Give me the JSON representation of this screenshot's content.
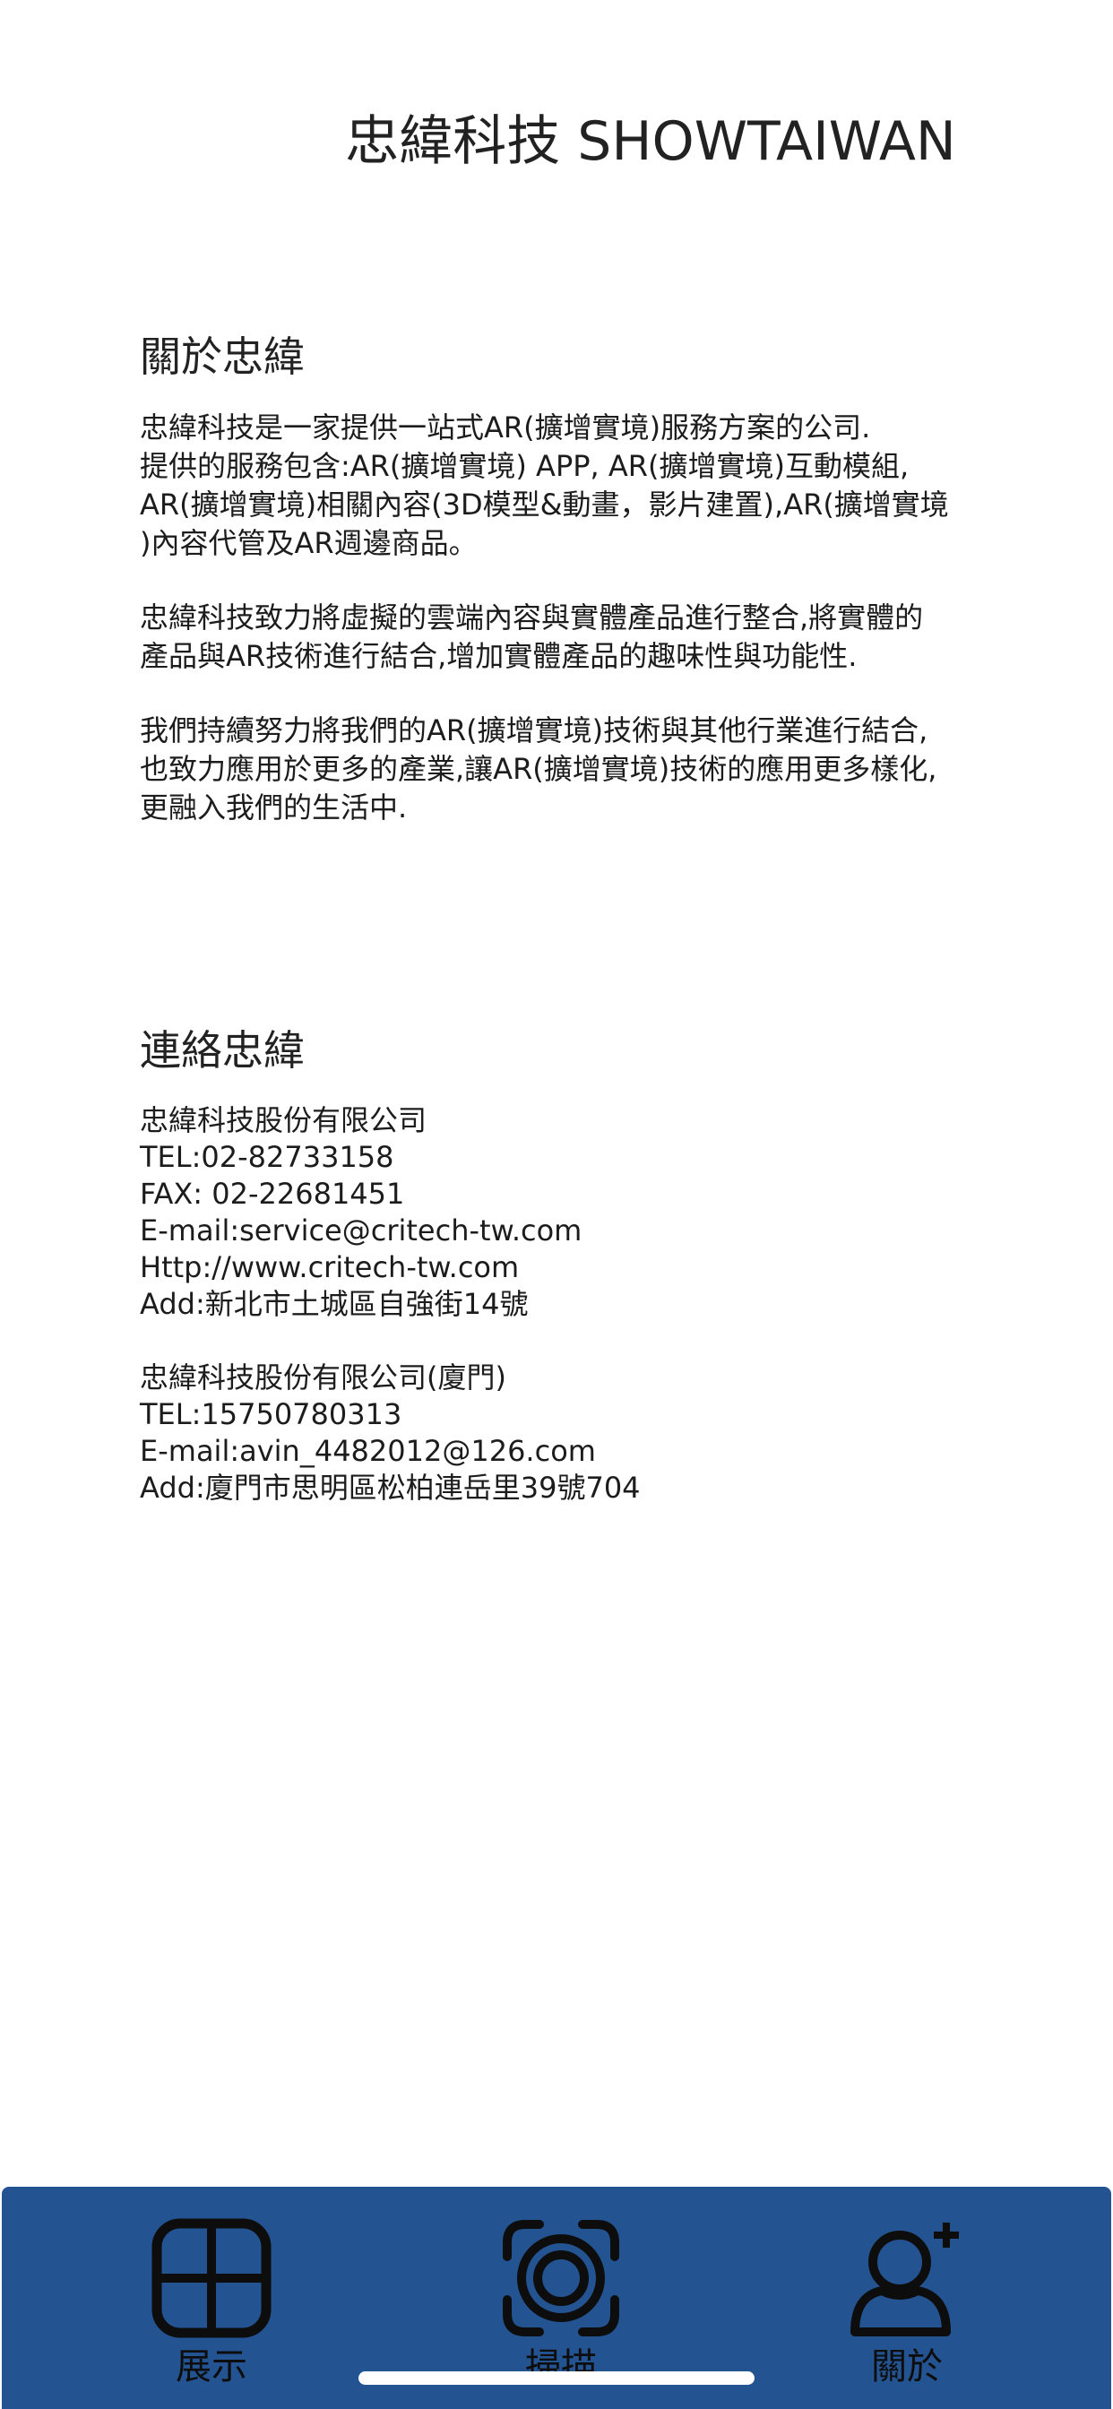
{
  "header": {
    "title": "忠緯科技 SHOWTAIWAN"
  },
  "about": {
    "heading": "關於忠緯",
    "paragraphs": [
      "忠緯科技是一家提供一站式AR(擴增實境)服務方案的公司.\n提供的服務包含:AR(擴增實境) APP, AR(擴增實境)互動模組,\nAR(擴增實境)相關內容(3D模型&動畫，影片建置),AR(擴增實境\n)內容代管及AR週邊商品。",
      "忠緯科技致力將虛擬的雲端內容與實體產品進行整合,將實體的\n產品與AR技術進行結合,增加實體產品的趣味性與功能性.",
      "我們持續努力將我們的AR(擴增實境)技術與其他行業進行結合,\n也致力應用於更多的產業,讓AR(擴增實境)技術的應用更多樣化,\n更融入我們的生活中."
    ]
  },
  "contact": {
    "heading": "連絡忠緯",
    "taipei": {
      "company": "忠緯科技股份有限公司",
      "tel": "TEL:02-82733158",
      "fax": "FAX: 02-22681451",
      "email": "E-mail:service@critech-tw.com",
      "web": "Http://www.critech-tw.com",
      "address": "Add:新北市土城區自強街14號"
    },
    "xiamen": {
      "company": "忠緯科技股份有限公司(廈門)",
      "tel": "TEL:15750780313",
      "email": "E-mail:avin_4482012@126.com",
      "address": "Add:廈門市思明區松柏連岳里39號704"
    }
  },
  "tabbar": {
    "background": "#235391",
    "tabs": [
      {
        "label": "展示",
        "icon": "grid-icon"
      },
      {
        "label": "掃描",
        "icon": "scan-target-icon"
      },
      {
        "label": "關於",
        "icon": "add-user-icon"
      }
    ]
  }
}
